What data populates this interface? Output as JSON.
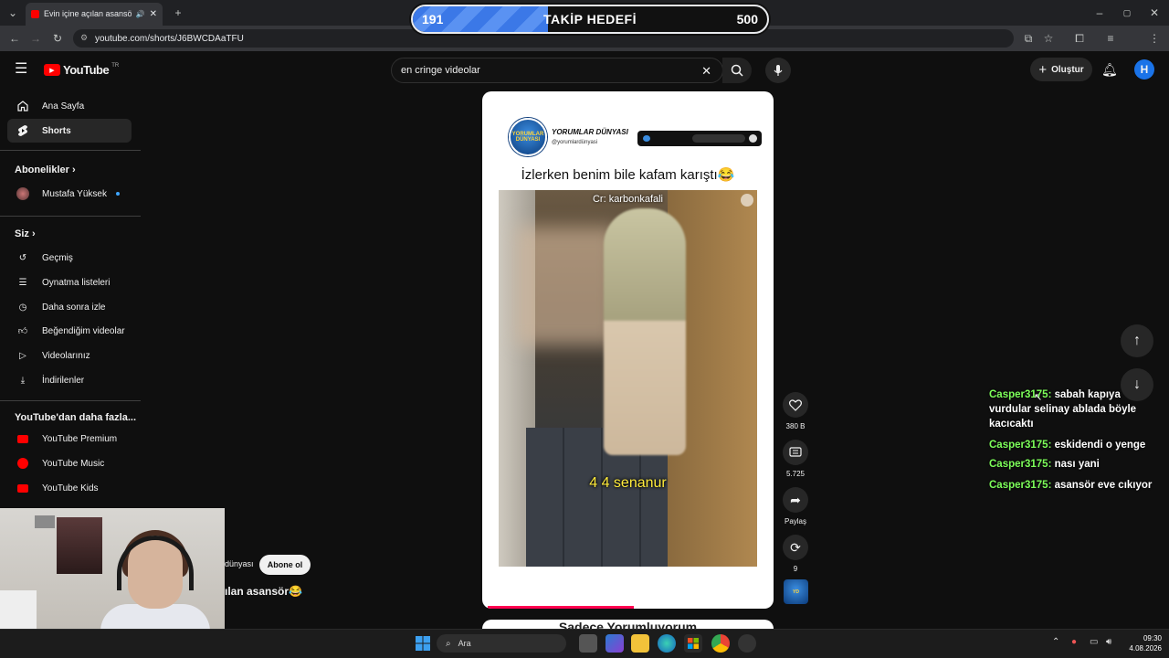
{
  "browser": {
    "tab_title": "Evin içine açılan asansör😂",
    "url": "youtube.com/shorts/J6BWCDAaTFU"
  },
  "goal_overlay": {
    "current": "191",
    "label": "TAKİP HEDEFİ",
    "target": "500",
    "progress_fraction": 0.382
  },
  "youtube": {
    "logo_text": "YouTube",
    "region": "TR",
    "search_value": "en cringe videolar",
    "create_label": "Oluştur",
    "avatar_letter": "H"
  },
  "sidebar": {
    "home": "Ana Sayfa",
    "shorts": "Shorts",
    "subscriptions_heading": "Abonelikler",
    "subscription_1": "Mustafa Yüksek",
    "you_heading": "Siz",
    "history": "Geçmiş",
    "playlists": "Oynatma listeleri",
    "watch_later": "Daha sonra izle",
    "liked": "Beğendiğim videolar",
    "your_videos": "Videolarınız",
    "downloads": "İndirilenler",
    "more_heading": "YouTube'dan daha fazla...",
    "premium": "YouTube Premium",
    "music": "YouTube Music",
    "kids": "YouTube Kids"
  },
  "short": {
    "channel_name": "YORUMLAR DÜNYASI",
    "channel_handle": "@yorumlardünyasi",
    "logo_text": "YORUMLAR DÜNYASI",
    "caption": "İzlerken benim bile kafam karıştı😂",
    "video_credit": "Cr: karbonkafali",
    "video_subtitle": "4 4 senanur",
    "likes": "380 B",
    "comments": "5.725",
    "share": "Paylaş",
    "remix": "9",
    "progress_fraction": 0.5,
    "next_card_text": "Sadece Yorumluyorum"
  },
  "overlay": {
    "channel_partial": "dünyası",
    "subscribe": "Abone ol",
    "title_partial": "ılan asansör😂"
  },
  "chat": [
    {
      "user": "Casper3175:",
      "text": "sabah kapıya vurdular selinay ablada böyle kacıcaktı"
    },
    {
      "user": "Casper3175:",
      "text": "eskidendi o yenge"
    },
    {
      "user": "Casper3175:",
      "text": "nası yani"
    },
    {
      "user": "Casper3175:",
      "text": "asansör eve cıkıyor"
    }
  ],
  "taskbar": {
    "search_placeholder": "Ara",
    "time": "09:30",
    "date": "4.08.2026"
  },
  "colors": {
    "youtube_red": "#ff0000",
    "chat_user": "#7dff5a",
    "goal_fill": "#3b78e7",
    "progress": "#ff0050"
  }
}
